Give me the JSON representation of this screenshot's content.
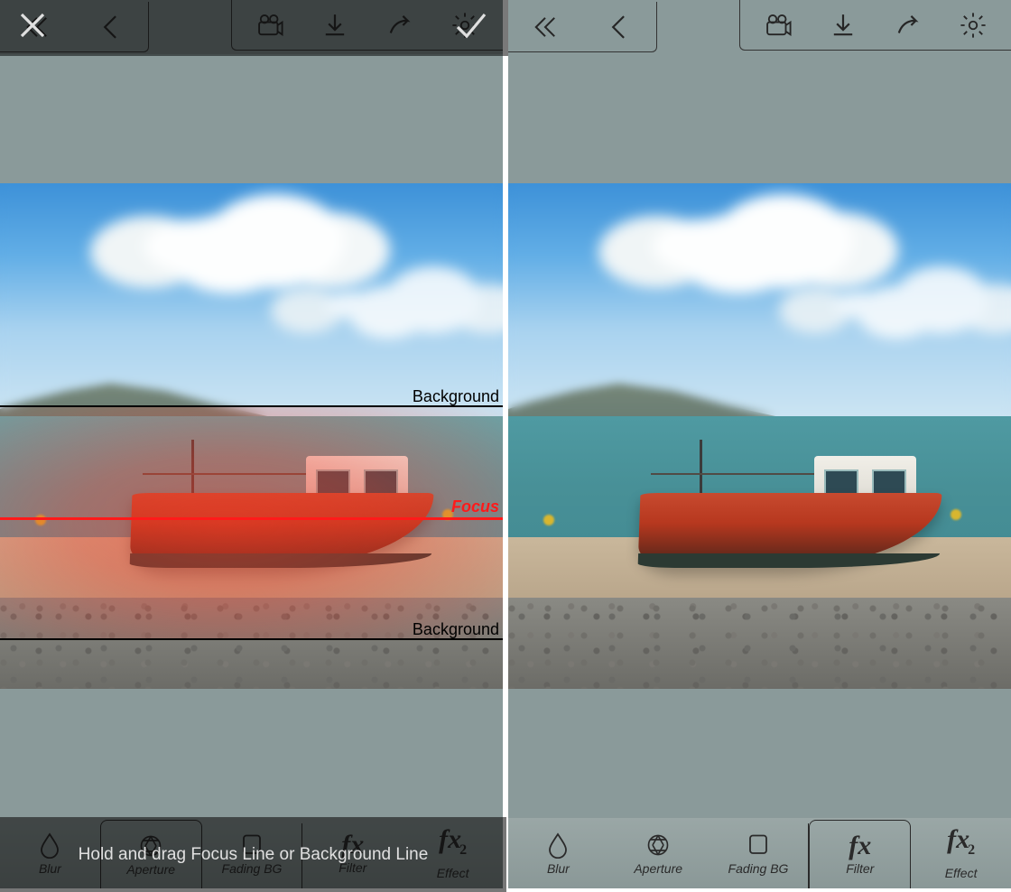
{
  "left": {
    "toolbar": {
      "close": "close",
      "confirm": "confirm"
    },
    "lines": {
      "topBackground": "Background",
      "focus": "Focus",
      "bottomBackground": "Background"
    },
    "hint": "Hold and drag Focus Line or Background Line",
    "tools": {
      "blur": "Blur",
      "aperture": "Aperture",
      "fadingbg": "Fading BG",
      "filter": "Filter",
      "effect": "Effect"
    }
  },
  "right": {
    "tools": {
      "blur": "Blur",
      "aperture": "Aperture",
      "fadingbg": "Fading BG",
      "filter": "Filter",
      "effect": "Effect"
    }
  }
}
